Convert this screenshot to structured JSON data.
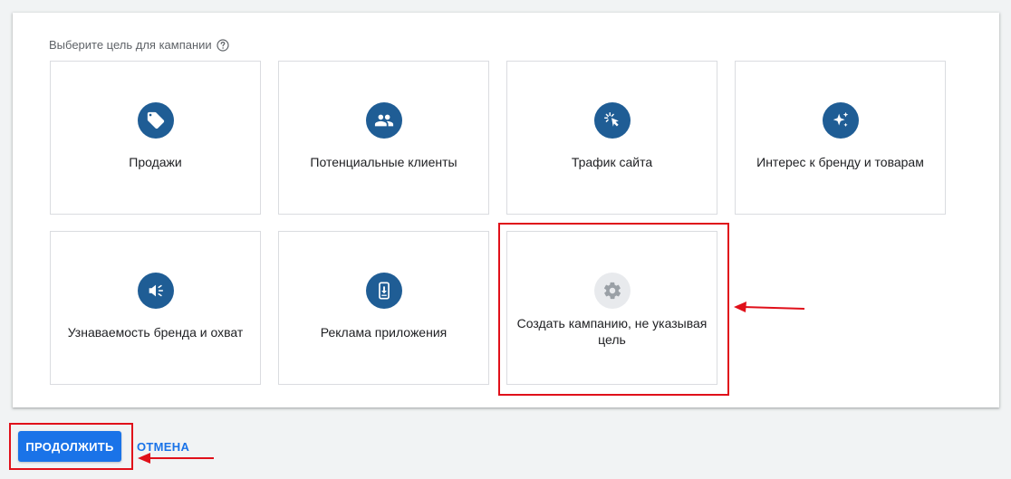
{
  "page": {
    "heading": "Выберите цель для кампании"
  },
  "goals": [
    {
      "label": "Продажи",
      "icon": "tag-icon"
    },
    {
      "label": "Потенциальные клиенты",
      "icon": "people-icon"
    },
    {
      "label": "Трафик сайта",
      "icon": "cursor-click-icon"
    },
    {
      "label": "Интерес к бренду и товарам",
      "icon": "sparkle-icon"
    },
    {
      "label": "Узнаваемость бренда и охват",
      "icon": "speaker-icon"
    },
    {
      "label": "Реклама приложения",
      "icon": "mobile-download-icon"
    },
    {
      "label": "Создать кампанию, не указывая цель",
      "icon": "gear-icon"
    }
  ],
  "actions": {
    "continue_label": "ПРОДОЛЖИТЬ",
    "cancel_label": "ОТМЕНА"
  },
  "colors": {
    "primary": "#1a73e8",
    "icon_bg": "#1f5d95",
    "annotation": "#e0101a"
  }
}
